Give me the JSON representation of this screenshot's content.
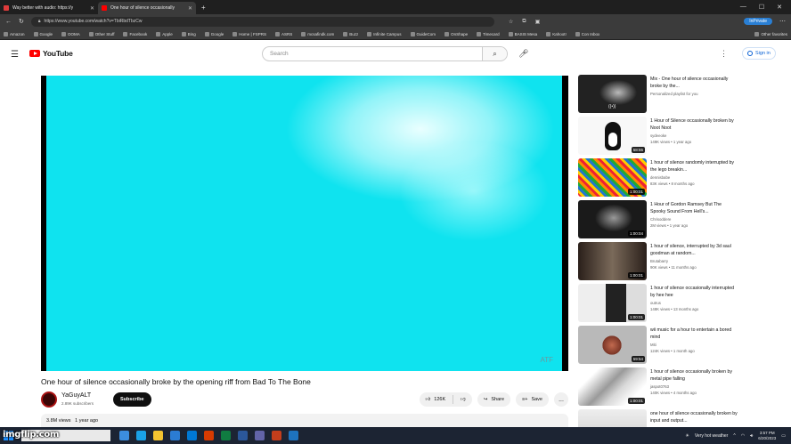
{
  "browser": {
    "tabs": [
      {
        "label": "Way better with audio: https://y",
        "active": false
      },
      {
        "label": "One hour of silence occasionally",
        "active": true
      }
    ],
    "new_tab": "+",
    "url": "https://www.youtube.com/watch?v=TbiRbdTbzCw",
    "profile_label": "InPrivate",
    "bookmarks": [
      "Amazon",
      "Google",
      "OOMA",
      "Other Stuff",
      "Facebook",
      "Apple",
      "Bing",
      "Google",
      "Home | FSPRS",
      "ASRS",
      "mcsafindk.com",
      "Buzz",
      "Infinite Campus",
      "GuideCom",
      "OnShape",
      "Timecard",
      "BASIS Mesa",
      "Kahoot!",
      "Con Inbox"
    ],
    "bookmarks_other": "Other favorites"
  },
  "youtube": {
    "logo_text": "YouTube",
    "search_placeholder": "Search",
    "signin_label": "Sign in"
  },
  "video": {
    "title": "One hour of silence occasionally broke by the opening riff from Bad To The Bone",
    "channel": "YaGuyALT",
    "subscribers": "2.89K subscribers",
    "subscribe_label": "Subscribe",
    "likes": "126K",
    "share_label": "Share",
    "save_label": "Save",
    "more_label": "...",
    "views": "3.8M views",
    "age": "1 year ago",
    "watermark": "ATF"
  },
  "recommendations": [
    {
      "title": "Mix - One hour of silence occasionally broke by the...",
      "channel": "Personalized playlist for you",
      "meta": "",
      "duration": "",
      "thumb": "t1"
    },
    {
      "title": "1 Hour of Silence occasionally broken by Noot Noot",
      "channel": "sydeeoke",
      "meta": "149K views • 1 year ago",
      "duration": "58:55",
      "thumb": "t2"
    },
    {
      "title": "1 hour of silence randomly interrupted by the lego breakin...",
      "channel": "dennisbabe",
      "meta": "83K views • 8 months ago",
      "duration": "1:00:01",
      "thumb": "t3"
    },
    {
      "title": "1 Hour of Gordon Ramsey But The Spooky Sound From Hell's...",
      "channel": "Chrisoddere",
      "meta": "2M views • 1 year ago",
      "duration": "1:00:04",
      "thumb": "t4"
    },
    {
      "title": "1 hour of silence, interrupted by 3d saul goodman at random...",
      "channel": "Brutabarry",
      "meta": "90K views • 11 months ago",
      "duration": "1:00:01",
      "thumb": "t5"
    },
    {
      "title": "1 hour of silence occasionally interrupted by hee hee",
      "channel": "outrus",
      "meta": "148K views • 13 months ago",
      "duration": "1:00:01",
      "thumb": "t6"
    },
    {
      "title": "wii music for a hour to entertain a bored mind",
      "channel": "Miti",
      "meta": "124K views • 1 month ago",
      "duration": "59:54",
      "thumb": "t7"
    },
    {
      "title": "1 hour of silence occasionally broken by metal pipe falling",
      "channel": "jaspot0763",
      "meta": "140K views • 4 months ago",
      "duration": "1:00:01",
      "thumb": "t8"
    },
    {
      "title": "one hour of silence occasionally broken by input and output...",
      "channel": "",
      "meta": "",
      "duration": "",
      "thumb": "t9"
    }
  ],
  "taskbar": {
    "search_text": "ere to search",
    "weather": "Very hot weather",
    "time": "3:57 PM",
    "date": "6/20/2023"
  },
  "overlay": {
    "imgflip": "imgflip.com"
  }
}
